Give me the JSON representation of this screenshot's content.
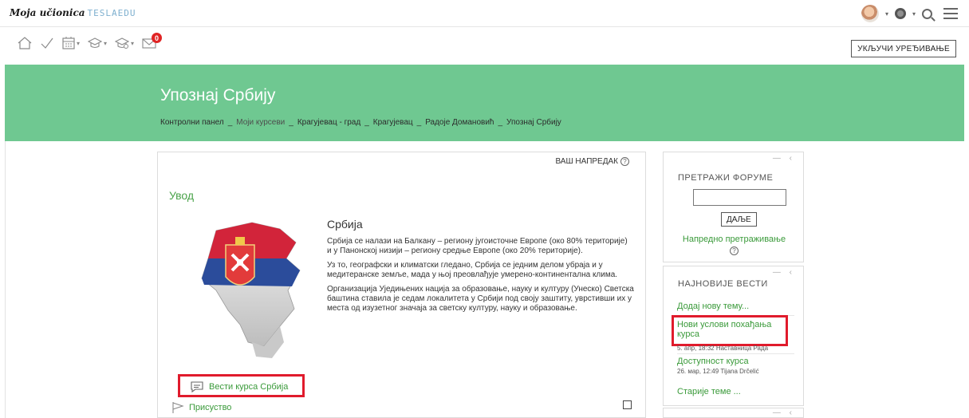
{
  "header": {
    "logo_text": "Moja učionica",
    "logo_brand": "TESLAEDU",
    "edit_button": "УКЉУЧИ УРЕЂИВАЊЕ",
    "notification_count": "0"
  },
  "course": {
    "title": "Упознај Србију",
    "breadcrumb": [
      "Контролни панел",
      "Моји курсеви",
      "Крагујевац - град",
      "Крагујевац",
      "Радоје Домановић",
      "Упознај Србију"
    ],
    "breadcrumb_sep": "_"
  },
  "main": {
    "progress_label": "ВАШ НАПРЕДАК",
    "help_glyph": "?",
    "section_title": "Увод",
    "intro_heading": "Србија",
    "intro_paragraphs": [
      "Србија се налази на Балкану – региону југоисточне Европе (око 80% територије) и у Панонској низији – региону средње Европе (око 20% територије).",
      "Уз то, географски и климатски гледано, Србија се једним делом убраја и у медитеранске земље, мада у њој преовлађује умерено-континентална клима.",
      "Организација Уједињених нација за образовање, науку и културу (Унеско) Светска баштина ставила је седам локалитета у Србији под своју заштиту, уврстивши их у места од изузетног значаја за светску културу, науку и образовање."
    ],
    "activities": [
      "Вести курса Србија",
      "Присуство"
    ]
  },
  "search_forums": {
    "title": "ПРЕТРАЖИ ФОРУМЕ",
    "go_button": "ДАЉЕ",
    "advanced_link": "Напредно претраживање"
  },
  "latest_news": {
    "title": "НАЈНОВИЈЕ ВЕСТИ",
    "add_topic": "Додај нову тему...",
    "items": [
      {
        "title": "Нови услови похађања курса",
        "meta": "5. апр, 18:32  Наставница Рада"
      },
      {
        "title": "Доступност курса",
        "meta": "26. мар, 12:49  Tijana Drčelić"
      }
    ],
    "older": "Старије теме ..."
  },
  "colors": {
    "banner": "#6fc891",
    "link": "#3a9a3a",
    "highlight": "#e01b2c",
    "badge": "#e02424"
  }
}
